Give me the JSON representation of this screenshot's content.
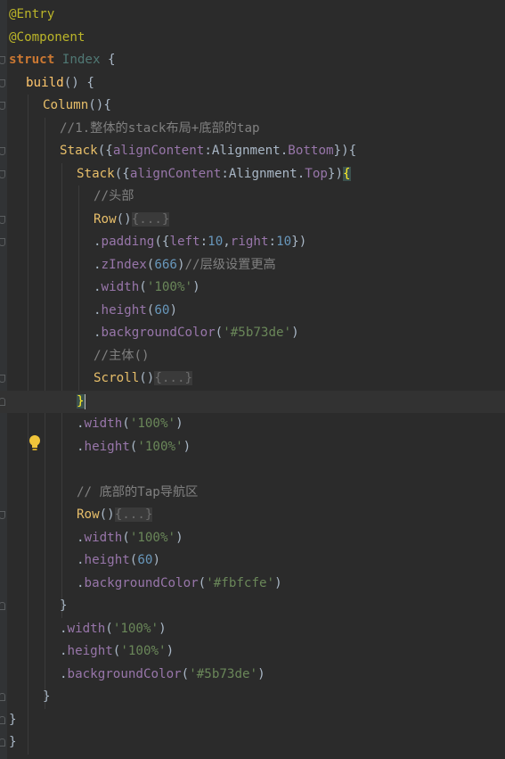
{
  "colors": {
    "background": "#2b2b2b",
    "annotation": "#bbb529",
    "keyword": "#cc7832",
    "struct_name": "#507874",
    "function": "#ffc66d",
    "component": "#e8bf6a",
    "property": "#9876aa",
    "number": "#6897bb",
    "string": "#6a8759",
    "comment": "#808080",
    "plain": "#a9b7c6",
    "bracket_highlight": "#3b514d",
    "folded": "#6b6b6b"
  },
  "editor": {
    "lines": [
      {
        "indent": 0,
        "tokens": [
          {
            "t": "@Entry",
            "c": "annotation"
          }
        ]
      },
      {
        "indent": 0,
        "tokens": [
          {
            "t": "@Component",
            "c": "annotation"
          }
        ]
      },
      {
        "indent": 0,
        "tokens": [
          {
            "t": "struct ",
            "c": "keyword"
          },
          {
            "t": "Index",
            "c": "struct_name"
          },
          {
            "t": " {",
            "c": "plain"
          }
        ]
      },
      {
        "indent": 1,
        "tokens": [
          {
            "t": "build",
            "c": "function"
          },
          {
            "t": "() {",
            "c": "plain"
          }
        ]
      },
      {
        "indent": 2,
        "tokens": [
          {
            "t": "Column",
            "c": "component"
          },
          {
            "t": "(){",
            "c": "plain"
          }
        ]
      },
      {
        "indent": 3,
        "tokens": [
          {
            "t": "//1.整体的stack布局+底部的tap",
            "c": "comment"
          }
        ]
      },
      {
        "indent": 3,
        "tokens": [
          {
            "t": "Stack",
            "c": "component"
          },
          {
            "t": "({",
            "c": "plain"
          },
          {
            "t": "alignContent",
            "c": "property"
          },
          {
            "t": ":Alignment.",
            "c": "plain"
          },
          {
            "t": "Bottom",
            "c": "property"
          },
          {
            "t": "}){",
            "c": "plain"
          }
        ]
      },
      {
        "indent": 4,
        "tokens": [
          {
            "t": "Stack",
            "c": "component"
          },
          {
            "t": "({",
            "c": "plain"
          },
          {
            "t": "alignContent",
            "c": "property"
          },
          {
            "t": ":Alignment.",
            "c": "plain"
          },
          {
            "t": "Top",
            "c": "property"
          },
          {
            "t": "})",
            "c": "plain"
          },
          {
            "t": "{",
            "c": "bracket"
          }
        ]
      },
      {
        "indent": 5,
        "tokens": [
          {
            "t": "//头部",
            "c": "comment"
          }
        ]
      },
      {
        "indent": 5,
        "tokens": [
          {
            "t": "Row",
            "c": "component"
          },
          {
            "t": "()",
            "c": "plain"
          },
          {
            "t": "{...}",
            "c": "folded"
          }
        ]
      },
      {
        "indent": 5,
        "tokens": [
          {
            "t": ".",
            "c": "plain"
          },
          {
            "t": "padding",
            "c": "property"
          },
          {
            "t": "({",
            "c": "plain"
          },
          {
            "t": "left",
            "c": "property"
          },
          {
            "t": ":",
            "c": "plain"
          },
          {
            "t": "10",
            "c": "number"
          },
          {
            "t": ",",
            "c": "plain"
          },
          {
            "t": "right",
            "c": "property"
          },
          {
            "t": ":",
            "c": "plain"
          },
          {
            "t": "10",
            "c": "number"
          },
          {
            "t": "})",
            "c": "plain"
          }
        ]
      },
      {
        "indent": 5,
        "tokens": [
          {
            "t": ".",
            "c": "plain"
          },
          {
            "t": "zIndex",
            "c": "property"
          },
          {
            "t": "(",
            "c": "plain"
          },
          {
            "t": "666",
            "c": "number"
          },
          {
            "t": ")",
            "c": "plain"
          },
          {
            "t": "//层级设置更高",
            "c": "comment"
          }
        ]
      },
      {
        "indent": 5,
        "tokens": [
          {
            "t": ".",
            "c": "plain"
          },
          {
            "t": "width",
            "c": "property"
          },
          {
            "t": "(",
            "c": "plain"
          },
          {
            "t": "'100%'",
            "c": "string"
          },
          {
            "t": ")",
            "c": "plain"
          }
        ]
      },
      {
        "indent": 5,
        "tokens": [
          {
            "t": ".",
            "c": "plain"
          },
          {
            "t": "height",
            "c": "property"
          },
          {
            "t": "(",
            "c": "plain"
          },
          {
            "t": "60",
            "c": "number"
          },
          {
            "t": ")",
            "c": "plain"
          }
        ]
      },
      {
        "indent": 5,
        "tokens": [
          {
            "t": ".",
            "c": "plain"
          },
          {
            "t": "backgroundColor",
            "c": "property"
          },
          {
            "t": "(",
            "c": "plain"
          },
          {
            "t": "'#5b73de'",
            "c": "string"
          },
          {
            "t": ")",
            "c": "plain"
          }
        ]
      },
      {
        "indent": 5,
        "tokens": [
          {
            "t": "//主体()",
            "c": "comment"
          }
        ]
      },
      {
        "indent": 5,
        "tokens": [
          {
            "t": "Scroll",
            "c": "component"
          },
          {
            "t": "()",
            "c": "plain"
          },
          {
            "t": "{...}",
            "c": "folded"
          }
        ]
      },
      {
        "indent": 4,
        "current": true,
        "tokens": [
          {
            "t": "}",
            "c": "bracket"
          }
        ]
      },
      {
        "indent": 4,
        "tokens": [
          {
            "t": ".",
            "c": "plain"
          },
          {
            "t": "width",
            "c": "property"
          },
          {
            "t": "(",
            "c": "plain"
          },
          {
            "t": "'100%'",
            "c": "string"
          },
          {
            "t": ")",
            "c": "plain"
          }
        ]
      },
      {
        "indent": 4,
        "tokens": [
          {
            "t": ".",
            "c": "plain"
          },
          {
            "t": "height",
            "c": "property"
          },
          {
            "t": "(",
            "c": "plain"
          },
          {
            "t": "'100%'",
            "c": "string"
          },
          {
            "t": ")",
            "c": "plain"
          }
        ]
      },
      {
        "indent": 0,
        "tokens": []
      },
      {
        "indent": 4,
        "tokens": [
          {
            "t": "// 底部的Tap导航区",
            "c": "comment"
          }
        ]
      },
      {
        "indent": 4,
        "tokens": [
          {
            "t": "Row",
            "c": "component"
          },
          {
            "t": "()",
            "c": "plain"
          },
          {
            "t": "{...}",
            "c": "folded"
          }
        ]
      },
      {
        "indent": 4,
        "tokens": [
          {
            "t": ".",
            "c": "plain"
          },
          {
            "t": "width",
            "c": "property"
          },
          {
            "t": "(",
            "c": "plain"
          },
          {
            "t": "'100%'",
            "c": "string"
          },
          {
            "t": ")",
            "c": "plain"
          }
        ]
      },
      {
        "indent": 4,
        "tokens": [
          {
            "t": ".",
            "c": "plain"
          },
          {
            "t": "height",
            "c": "property"
          },
          {
            "t": "(",
            "c": "plain"
          },
          {
            "t": "60",
            "c": "number"
          },
          {
            "t": ")",
            "c": "plain"
          }
        ]
      },
      {
        "indent": 4,
        "tokens": [
          {
            "t": ".",
            "c": "plain"
          },
          {
            "t": "backgroundColor",
            "c": "property"
          },
          {
            "t": "(",
            "c": "plain"
          },
          {
            "t": "'#fbfcfe'",
            "c": "string"
          },
          {
            "t": ")",
            "c": "plain"
          }
        ]
      },
      {
        "indent": 3,
        "tokens": [
          {
            "t": "}",
            "c": "plain"
          }
        ]
      },
      {
        "indent": 3,
        "tokens": [
          {
            "t": ".",
            "c": "plain"
          },
          {
            "t": "width",
            "c": "property"
          },
          {
            "t": "(",
            "c": "plain"
          },
          {
            "t": "'100%'",
            "c": "string"
          },
          {
            "t": ")",
            "c": "plain"
          }
        ]
      },
      {
        "indent": 3,
        "tokens": [
          {
            "t": ".",
            "c": "plain"
          },
          {
            "t": "height",
            "c": "property"
          },
          {
            "t": "(",
            "c": "plain"
          },
          {
            "t": "'100%'",
            "c": "string"
          },
          {
            "t": ")",
            "c": "plain"
          }
        ]
      },
      {
        "indent": 3,
        "tokens": [
          {
            "t": ".",
            "c": "plain"
          },
          {
            "t": "backgroundColor",
            "c": "property"
          },
          {
            "t": "(",
            "c": "plain"
          },
          {
            "t": "'#5b73de'",
            "c": "string"
          },
          {
            "t": ")",
            "c": "plain"
          }
        ]
      },
      {
        "indent": 2,
        "tokens": [
          {
            "t": "}",
            "c": "plain"
          }
        ]
      },
      {
        "indent": 0,
        "tokens": [
          {
            "t": "}",
            "c": "plain"
          }
        ]
      },
      {
        "indent": 0,
        "tokens": [
          {
            "t": "}",
            "c": "plain"
          }
        ]
      }
    ],
    "intention_icon": "lightbulb-icon"
  }
}
